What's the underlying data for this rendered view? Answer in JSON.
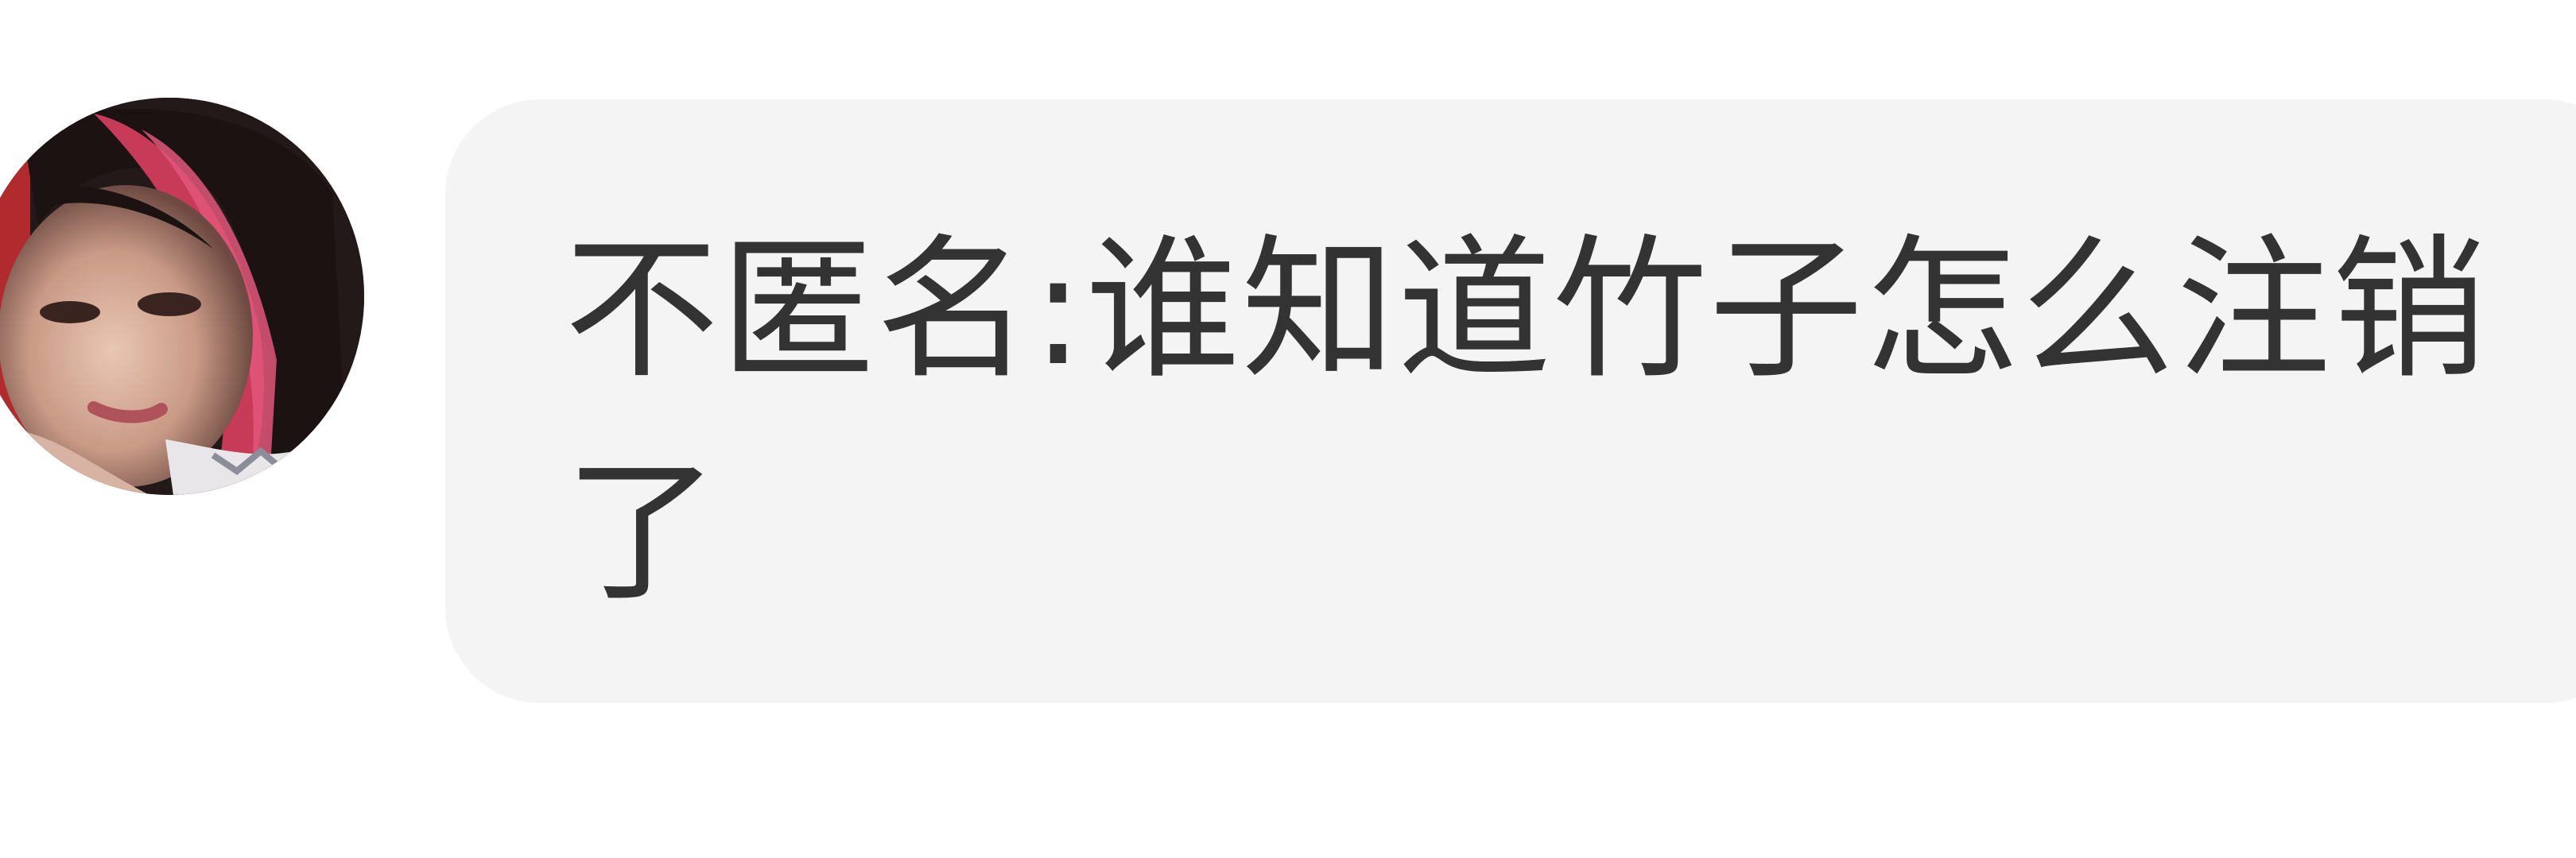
{
  "message": {
    "sender_avatar": "avatar-photo",
    "text": "不匿名:谁知道竹子怎么注销了"
  },
  "colors": {
    "bubble_background": "#f4f4f4",
    "text": "#333333",
    "page_background": "#ffffff"
  }
}
